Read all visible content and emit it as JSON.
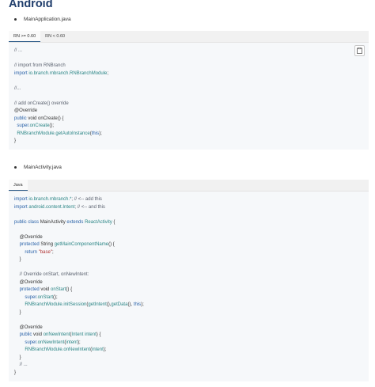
{
  "page_title": "Android",
  "section1": {
    "bullet": "MainApplication.java",
    "tabs": [
      "RN >= 0.60",
      "RN < 0.60"
    ],
    "lines": [
      [
        [
          "// ...",
          "c"
        ]
      ],
      [],
      [
        [
          "// import from RNBranch",
          "c"
        ]
      ],
      [
        [
          "import ",
          "k"
        ],
        [
          "io.branch.rnbranch.RNBranchModule",
          "f"
        ],
        [
          ";",
          "t"
        ]
      ],
      [],
      [
        [
          "//...",
          "c"
        ]
      ],
      [],
      [
        [
          "// add onCreate() override",
          "c"
        ]
      ],
      [
        [
          "@Override",
          "t"
        ]
      ],
      [
        [
          "public ",
          "k"
        ],
        [
          "void ",
          "t"
        ],
        [
          "onCreate",
          "t"
        ],
        [
          "() {",
          "t"
        ]
      ],
      [
        [
          "  super",
          "k"
        ],
        [
          ".onCreate",
          "f"
        ],
        [
          "();",
          "t"
        ]
      ],
      [
        [
          "  RNBranchModule",
          "f"
        ],
        [
          ".getAutoInstance",
          "f"
        ],
        [
          "(",
          "t"
        ],
        [
          "this",
          "k"
        ],
        [
          ");",
          "t"
        ]
      ],
      [
        [
          "}",
          "t"
        ]
      ]
    ]
  },
  "section2": {
    "bullet": "MainActivity.java",
    "tabs": [
      "Java"
    ],
    "lines": [
      [
        [
          "import ",
          "k"
        ],
        [
          "io.branch.rnbranch.*",
          "f"
        ],
        [
          "; // <-- add this",
          "c"
        ]
      ],
      [
        [
          "import ",
          "k"
        ],
        [
          "android.content.Intent",
          "f"
        ],
        [
          "; // <-- and this",
          "c"
        ]
      ],
      [],
      [
        [
          "public ",
          "k"
        ],
        [
          "class ",
          "k"
        ],
        [
          "MainActivity ",
          "t"
        ],
        [
          "extends ",
          "k"
        ],
        [
          "ReactActivity",
          "f"
        ],
        [
          " {",
          "t"
        ]
      ],
      [],
      [
        [
          "    @Override",
          "t"
        ]
      ],
      [
        [
          "    protected ",
          "k"
        ],
        [
          "String ",
          "t"
        ],
        [
          "getMainComponentName",
          "f"
        ],
        [
          "() {",
          "t"
        ]
      ],
      [
        [
          "        return ",
          "k"
        ],
        [
          "\"base\"",
          "s"
        ],
        [
          ";",
          "t"
        ]
      ],
      [
        [
          "    }",
          "t"
        ]
      ],
      [],
      [
        [
          "    // Override onStart, onNewIntent:",
          "c"
        ]
      ],
      [
        [
          "    @Override",
          "t"
        ]
      ],
      [
        [
          "    protected ",
          "k"
        ],
        [
          "void ",
          "t"
        ],
        [
          "onStart",
          "f"
        ],
        [
          "() {",
          "t"
        ]
      ],
      [
        [
          "        super",
          "k"
        ],
        [
          ".onStart",
          "f"
        ],
        [
          "();",
          "t"
        ]
      ],
      [
        [
          "        RNBranchModule",
          "f"
        ],
        [
          ".initSession",
          "f"
        ],
        [
          "(",
          "t"
        ],
        [
          "getIntent",
          "f"
        ],
        [
          "(),",
          "t"
        ],
        [
          "getData",
          "f"
        ],
        [
          "(), ",
          "t"
        ],
        [
          "this",
          "k"
        ],
        [
          ");",
          "t"
        ]
      ],
      [
        [
          "    }",
          "t"
        ]
      ],
      [],
      [
        [
          "    @Override",
          "t"
        ]
      ],
      [
        [
          "    public ",
          "k"
        ],
        [
          "void ",
          "t"
        ],
        [
          "onNewIntent",
          "f"
        ],
        [
          "(",
          "t"
        ],
        [
          "Intent ",
          "f"
        ],
        [
          "intent",
          "f"
        ],
        [
          ") {",
          "t"
        ]
      ],
      [
        [
          "        super",
          "k"
        ],
        [
          ".onNewIntent",
          "f"
        ],
        [
          "(",
          "t"
        ],
        [
          "intent",
          "f"
        ],
        [
          ");",
          "t"
        ]
      ],
      [
        [
          "        RNBranchModule",
          "f"
        ],
        [
          ".onNewIntent",
          "f"
        ],
        [
          "(",
          "t"
        ],
        [
          "intent",
          "f"
        ],
        [
          ");",
          "t"
        ]
      ],
      [
        [
          "    }",
          "t"
        ]
      ],
      [
        [
          "    // ...",
          "c"
        ]
      ],
      [
        [
          "}",
          "t"
        ]
      ]
    ]
  }
}
